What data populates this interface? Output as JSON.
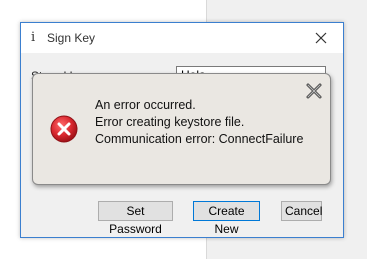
{
  "dialog": {
    "title": "Sign Key",
    "title_icon": "info-icon",
    "close_icon": "close-icon"
  },
  "form": {
    "field_label": "Stored key",
    "field_value": "Hola"
  },
  "buttons": {
    "set_password": "Set Password",
    "create_new": "Create New",
    "cancel": "Cancel"
  },
  "error_popup": {
    "icon": "error-icon",
    "close_icon": "close-icon",
    "lines": [
      "An error occurred.",
      "Error creating keystore file.",
      "Communication error: ConnectFailure"
    ]
  },
  "colors": {
    "dialog_border": "#3b7fcf",
    "error_red": "#d9282f",
    "popup_bg": "#eae7e2"
  }
}
